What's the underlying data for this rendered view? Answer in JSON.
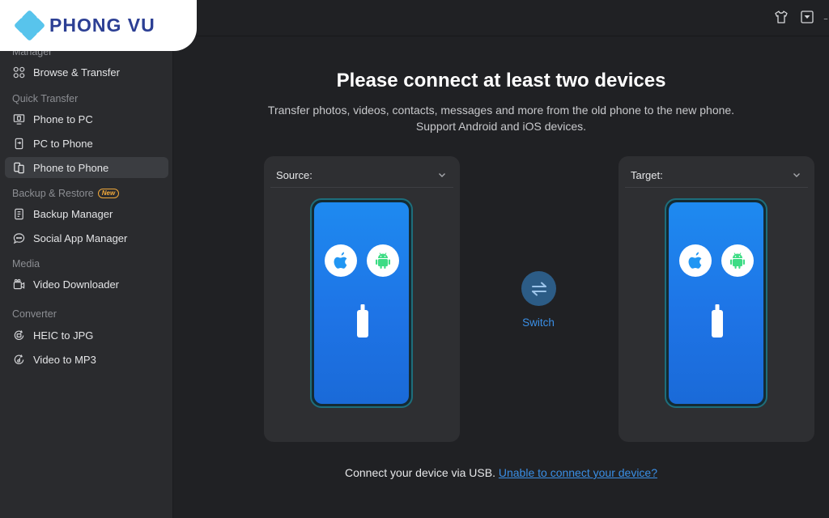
{
  "watermark": {
    "text": "PHONG VU"
  },
  "sidebar": {
    "sections": [
      {
        "label": "Manager"
      },
      {
        "label": "Quick Transfer"
      },
      {
        "label": "Backup & Restore",
        "badge": "New"
      },
      {
        "label": "Media"
      },
      {
        "label": "Converter"
      }
    ],
    "items": [
      {
        "label": "Browse & Transfer",
        "icon": "apps-icon"
      },
      {
        "label": "Phone to PC",
        "icon": "phone-to-pc-icon"
      },
      {
        "label": "PC to Phone",
        "icon": "pc-to-phone-icon"
      },
      {
        "label": "Phone to Phone",
        "icon": "phone-to-phone-icon",
        "active": true
      },
      {
        "label": "Backup Manager",
        "icon": "backup-icon"
      },
      {
        "label": "Social App Manager",
        "icon": "chat-icon"
      },
      {
        "label": "Video Downloader",
        "icon": "video-download-icon"
      },
      {
        "label": "HEIC to JPG",
        "icon": "convert-image-icon"
      },
      {
        "label": "Video to MP3",
        "icon": "convert-audio-icon"
      }
    ]
  },
  "topbar": {
    "icons": [
      "tshirt-icon",
      "dropdown-box-icon",
      "minimize-icon"
    ]
  },
  "main": {
    "title": "Please connect at least two devices",
    "subtitle_line1": "Transfer photos, videos, contacts, messages and more from the old phone to the new phone.",
    "subtitle_line2": "Support Android and iOS devices.",
    "source": {
      "label": "Source:"
    },
    "target": {
      "label": "Target:"
    },
    "switch_label": "Switch",
    "footer_prefix": "Connect your device via USB.",
    "footer_link": "Unable to connect your device?"
  },
  "colors": {
    "accent": "#3a8fe6",
    "phone_screen": "#1e80ee",
    "android_green": "#3ddc84",
    "apple_blue": "#2196f3",
    "badge_orange": "#f0a83a"
  }
}
